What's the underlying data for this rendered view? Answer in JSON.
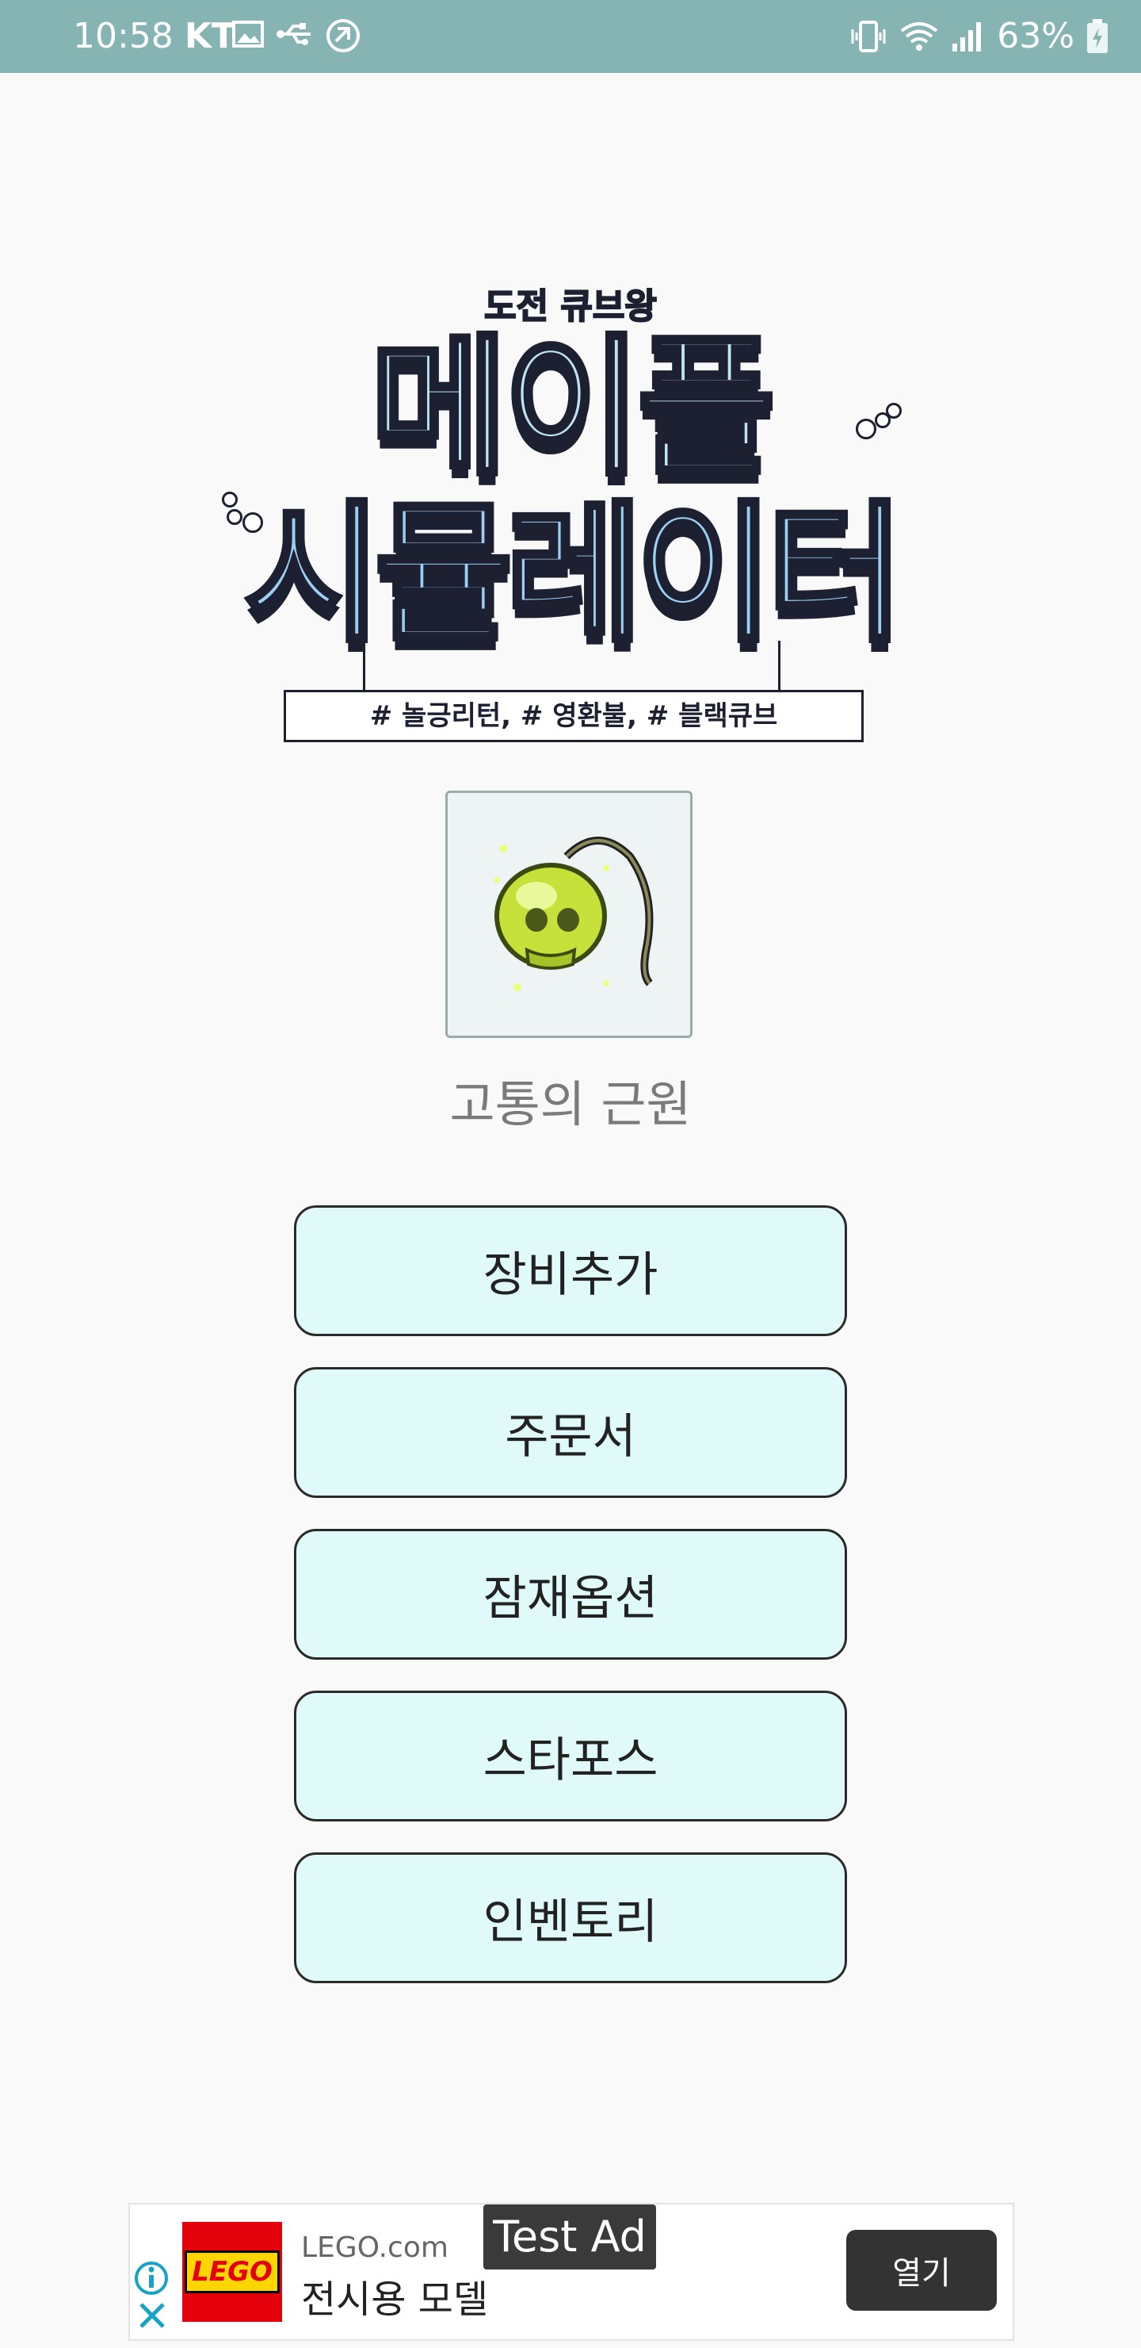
{
  "status_bar": {
    "time": "10:58",
    "carrier": "KT",
    "battery": "63%",
    "icons_left": [
      "image-icon",
      "usb-icon",
      "sync-icon"
    ],
    "icons_right": [
      "vibrate-icon",
      "wifi-icon",
      "signal-icon",
      "battery-icon"
    ]
  },
  "logo": {
    "subtitle": "도전 큐브왕",
    "line1": "메이플",
    "line2": "시뮬레이터",
    "tags": "# 놀긍리턴, # 영환불, # 블랙큐브"
  },
  "item": {
    "icon": "pendant-icon",
    "name": "고통의 근원"
  },
  "menu": {
    "buttons": [
      {
        "label": "장비추가"
      },
      {
        "label": "주문서"
      },
      {
        "label": "잠재옵션"
      },
      {
        "label": "스타포스"
      },
      {
        "label": "인벤토리"
      }
    ]
  },
  "ad": {
    "brand_logo": "LEGO",
    "domain": "LEGO.com",
    "title": "전시용 모델",
    "test_label": "Test Ad",
    "cta": "열기"
  },
  "colors": {
    "status_bar": "#86b4b3",
    "button_bg": "#e0f9f9",
    "button_border": "#2a2a2a",
    "background": "#f9f9f9"
  }
}
